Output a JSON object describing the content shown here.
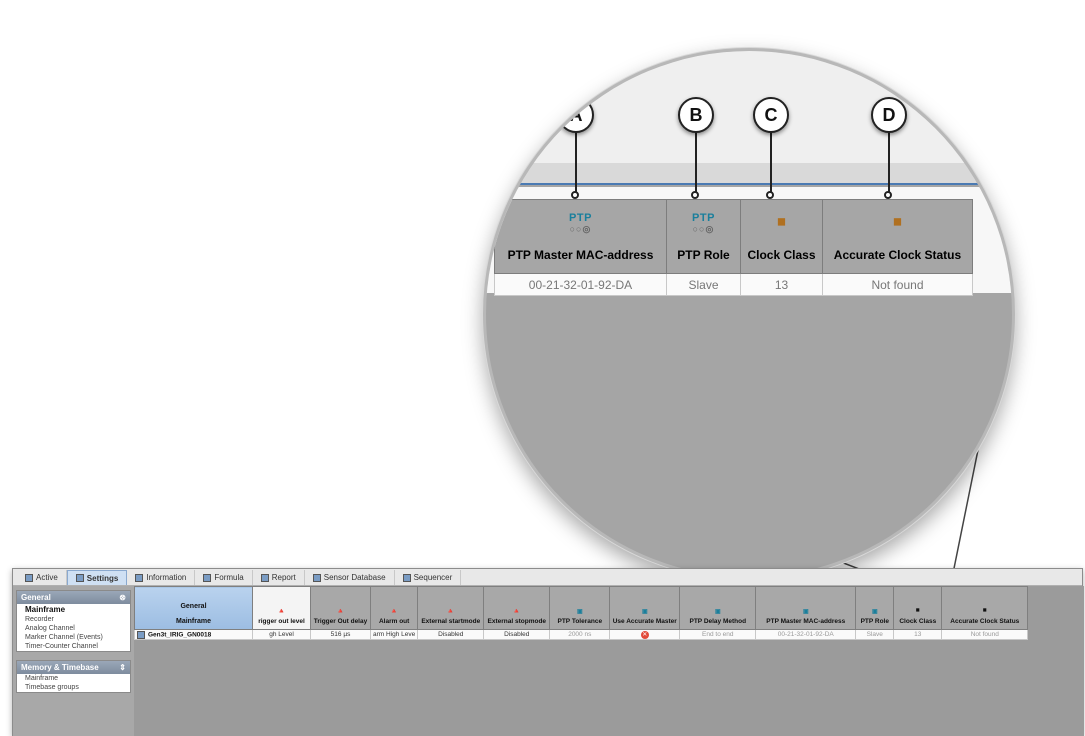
{
  "callouts": [
    "A",
    "B",
    "C",
    "D"
  ],
  "zoom": {
    "columns": [
      {
        "label": "PTP Master MAC-address",
        "icon": "ptp-icon",
        "icon_text": "PTP",
        "value": "00-21-32-01-92-DA"
      },
      {
        "label": "PTP Role",
        "icon": "ptp-icon",
        "icon_text": "PTP",
        "value": "Slave"
      },
      {
        "label": "Clock Class",
        "icon": "clock-class-icon",
        "value": "13"
      },
      {
        "label": "Accurate Clock Status",
        "icon": "clock-status-icon",
        "value": "Not found"
      }
    ],
    "dots": "○○◎"
  },
  "tabs": [
    {
      "label": "Active",
      "icon": "active-icon"
    },
    {
      "label": "Settings",
      "icon": "settings-icon",
      "active": true
    },
    {
      "label": "Information",
      "icon": "information-icon"
    },
    {
      "label": "Formula",
      "icon": "formula-icon"
    },
    {
      "label": "Report",
      "icon": "report-icon"
    },
    {
      "label": "Sensor Database",
      "icon": "sensor-database-icon"
    },
    {
      "label": "Sequencer",
      "icon": "sequencer-icon"
    }
  ],
  "sidebar": {
    "general": {
      "title": "General",
      "items": [
        "Mainframe",
        "Recorder",
        "Analog Channel",
        "Marker Channel (Events)",
        "Timer-Counter Channel"
      ]
    },
    "memory": {
      "title": "Memory & Timebase",
      "items": [
        "Mainframe",
        "Timebase groups"
      ]
    }
  },
  "grid": {
    "first_header": [
      "General",
      "Mainframe"
    ],
    "headers": [
      "rigger out level",
      "Trigger Out delay",
      "Alarm out",
      "External startmode",
      "External stopmode",
      "PTP Tolerance",
      "Use Accurate Master",
      "PTP Delay Method",
      "PTP Master MAC-address",
      "PTP Role",
      "Clock Class",
      "Accurate Clock Status"
    ],
    "row": {
      "name": "Gen3t_IRIG_GN0018",
      "values": [
        "gh Level",
        "516 µs",
        "arm High Leve",
        "Disabled",
        "Disabled",
        "2000 ns",
        "",
        "End to end",
        "00-21-32-01-92-DA",
        "Slave",
        "13",
        "Not found"
      ]
    }
  },
  "colors": {
    "accent": "#4a7ab3",
    "ptp": "#1a7f9c",
    "error": "#e24a3a"
  }
}
